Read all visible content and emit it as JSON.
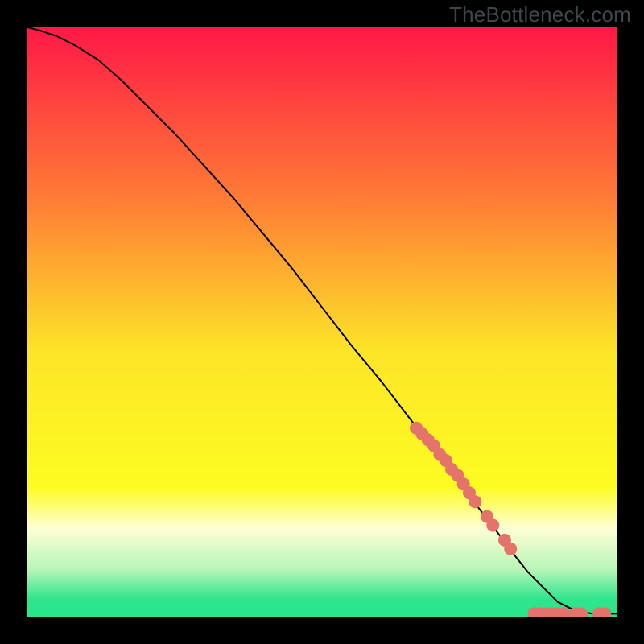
{
  "watermark": "TheBottleneck.com",
  "chart_data": {
    "type": "line",
    "title": "",
    "xlabel": "",
    "ylabel": "",
    "xlim": [
      0,
      100
    ],
    "ylim": [
      0,
      100
    ],
    "grid": false,
    "background_gradient": {
      "stops": [
        {
          "offset": 0.0,
          "color": "#ff1846"
        },
        {
          "offset": 0.3,
          "color": "#fe7f35"
        },
        {
          "offset": 0.55,
          "color": "#fde528"
        },
        {
          "offset": 0.78,
          "color": "#fdfc21"
        },
        {
          "offset": 0.85,
          "color": "#fefed4"
        },
        {
          "offset": 0.92,
          "color": "#b7f6b8"
        },
        {
          "offset": 0.97,
          "color": "#2fe58e"
        },
        {
          "offset": 1.0,
          "color": "#28e68a"
        }
      ]
    },
    "series": [
      {
        "name": "curve",
        "kind": "line",
        "color": "#000000",
        "x": [
          0,
          2,
          5,
          8,
          12,
          16,
          20,
          25,
          30,
          35,
          40,
          45,
          50,
          55,
          60,
          65,
          70,
          75,
          80,
          83,
          85,
          88,
          90,
          93,
          96,
          100
        ],
        "y": [
          100,
          99.5,
          98.5,
          97,
          94.5,
          91,
          87,
          82,
          76.5,
          71,
          65,
          59,
          52.5,
          46,
          40,
          33.5,
          27,
          20.5,
          14,
          10,
          7.5,
          4.5,
          2.5,
          1,
          0.5,
          0.5
        ]
      },
      {
        "name": "points-on-curve",
        "kind": "scatter",
        "color": "#e4746b",
        "radius": 8,
        "x": [
          66,
          67,
          68,
          69,
          70,
          71,
          72,
          73,
          74,
          75,
          76,
          78,
          79,
          81,
          82
        ],
        "y": [
          32,
          31,
          30,
          29,
          27.5,
          26.5,
          25,
          24,
          22.5,
          21,
          19.5,
          17,
          15.5,
          13,
          11.5
        ]
      },
      {
        "name": "points-bottom",
        "kind": "scatter",
        "color": "#e4746b",
        "radius": 8,
        "x": [
          86,
          87,
          88,
          89,
          90,
          91,
          93,
          94,
          97,
          98
        ],
        "y": [
          0.5,
          0.5,
          0.5,
          0.5,
          0.5,
          0.5,
          0.5,
          0.5,
          0.5,
          0.5
        ]
      }
    ]
  }
}
